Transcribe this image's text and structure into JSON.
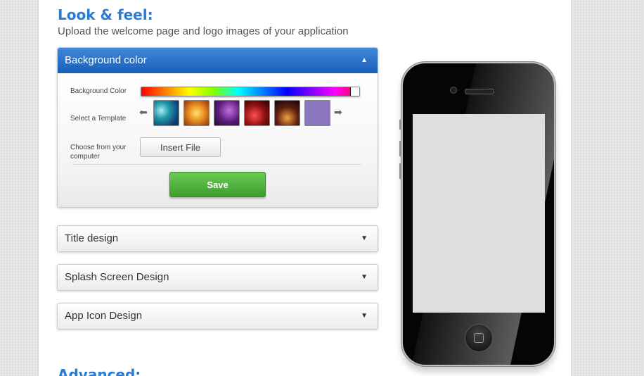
{
  "look_feel": {
    "title": "Look & feel:",
    "subtitle": "Upload the welcome page and logo images of your application"
  },
  "accordion": {
    "background": {
      "header": "Background color",
      "arrow": "▲",
      "color_label": "Background Color",
      "template_label": "Select a Template",
      "file_label": "Choose from your computer",
      "insert_button": "Insert File",
      "save_button": "Save",
      "prev_arrow": "⬅",
      "next_arrow": "➡",
      "templates": [
        "template-blue-tech",
        "template-orange-tech",
        "template-purple",
        "template-red-swirl",
        "template-dark-swirl",
        "template-lavender"
      ]
    },
    "title_design": {
      "header": "Title design",
      "arrow": "▼"
    },
    "splash_design": {
      "header": "Splash Screen Design",
      "arrow": "▼"
    },
    "app_icon_design": {
      "header": "App Icon Design",
      "arrow": "▼"
    }
  },
  "advanced": {
    "title": "Advanced:"
  },
  "colors": {
    "accent": "#2a7bd4",
    "active_header": "#1a5fb8",
    "save_green": "#3e9e2e",
    "phone_screen": "#dedede"
  }
}
